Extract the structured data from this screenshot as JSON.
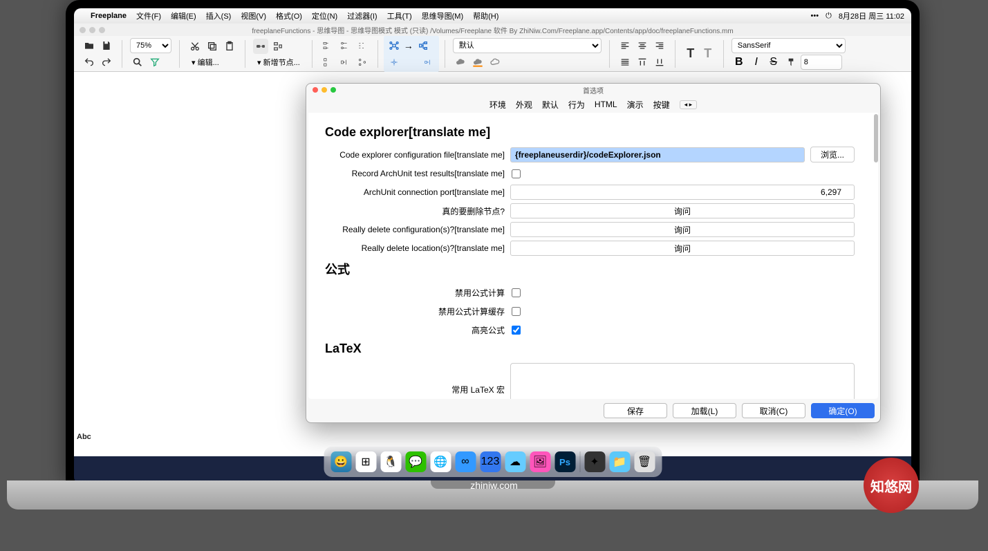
{
  "menubar": {
    "app": "Freeplane",
    "items": [
      "文件(F)",
      "编辑(E)",
      "插入(S)",
      "视图(V)",
      "格式(O)",
      "定位(N)",
      "过滤器(I)",
      "工具(T)",
      "思维导图(M)",
      "帮助(H)"
    ],
    "date": "8月28日 周三 11:02"
  },
  "titlebar": {
    "text": "freeplaneFunctions - 思维导图 - 思维导图模式 模式 (只读) /Volumes/Freeplane 软件 By ZhiNiw.Com/Freeplane.app/Contents/app/doc/freeplaneFunctions.mm"
  },
  "toolbar": {
    "zoom": "75%",
    "editLabel": "▾ 编辑...",
    "newNodeLabel": "▾ 新增节点...",
    "styleSelect": "默认",
    "fontSelect": "SansSerif",
    "fontSize": "8"
  },
  "abc": "Abc",
  "dialog": {
    "title": "首选项",
    "tabs": [
      "环境",
      "外观",
      "默认",
      "行为",
      "HTML",
      "演示",
      "按键"
    ],
    "sections": {
      "codeExplorer": {
        "heading": "Code explorer[translate me]",
        "configFileLabel": "Code explorer configuration file[translate me]",
        "configFileValue": "{freeplaneuserdir}/codeExplorer.json",
        "browseBtn": "浏览...",
        "recordArchLabel": "Record ArchUnit test results[translate me]",
        "archPortLabel": "ArchUnit connection port[translate me]",
        "archPortValue": "6,297",
        "deleteNodeLabel": "真的要删除节点?",
        "deleteNodeValue": "询问",
        "deleteConfigLabel": "Really delete configuration(s)?[translate me]",
        "deleteConfigValue": "询问",
        "deleteLocLabel": "Really delete location(s)?[translate me]",
        "deleteLocValue": "询问"
      },
      "formula": {
        "heading": "公式",
        "disableCalc": "禁用公式计算",
        "disableCache": "禁用公式计算缓存",
        "highlight": "高亮公式"
      },
      "latex": {
        "heading": "LaTeX",
        "macroLabel": "常用 LaTeX 宏"
      }
    },
    "footer": {
      "save": "保存",
      "load": "加载(L)",
      "cancel": "取消(C)",
      "ok": "确定(O)"
    }
  },
  "brand": "zhiniw.com",
  "stamp": "知悠网"
}
